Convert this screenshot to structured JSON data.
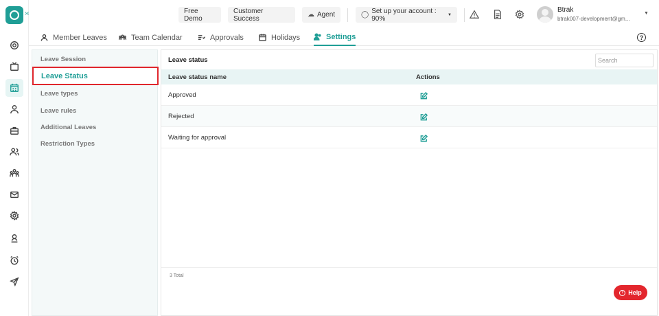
{
  "header": {
    "free_demo": "Free Demo",
    "customer_success": "Customer Success",
    "agent": "Agent",
    "setup": "Set up your account : 90%",
    "user_name": "Btrak",
    "user_email": "btrak007-development@gm..."
  },
  "tabs": [
    {
      "label": "Member Leaves",
      "icon": "user-icon"
    },
    {
      "label": "Team Calendar",
      "icon": "team-icon"
    },
    {
      "label": "Approvals",
      "icon": "approvals-icon"
    },
    {
      "label": "Holidays",
      "icon": "calendar-icon"
    },
    {
      "label": "Settings",
      "icon": "settings-user-icon"
    }
  ],
  "sidebar": {
    "items": [
      {
        "label": "Leave Session"
      },
      {
        "label": "Leave Status"
      },
      {
        "label": "Leave types"
      },
      {
        "label": "Leave rules"
      },
      {
        "label": "Additional Leaves"
      },
      {
        "label": "Restriction Types"
      }
    ]
  },
  "panel": {
    "title": "Leave status",
    "search_placeholder": "Search",
    "columns": [
      "Leave status name",
      "Actions"
    ],
    "rows": [
      {
        "name": "Approved"
      },
      {
        "name": "Rejected"
      },
      {
        "name": "Waiting for approval"
      }
    ],
    "total": "3 Total"
  },
  "help": {
    "label": "Help"
  },
  "colors": {
    "accent": "#1f9e96",
    "highlight": "#e0262c"
  }
}
